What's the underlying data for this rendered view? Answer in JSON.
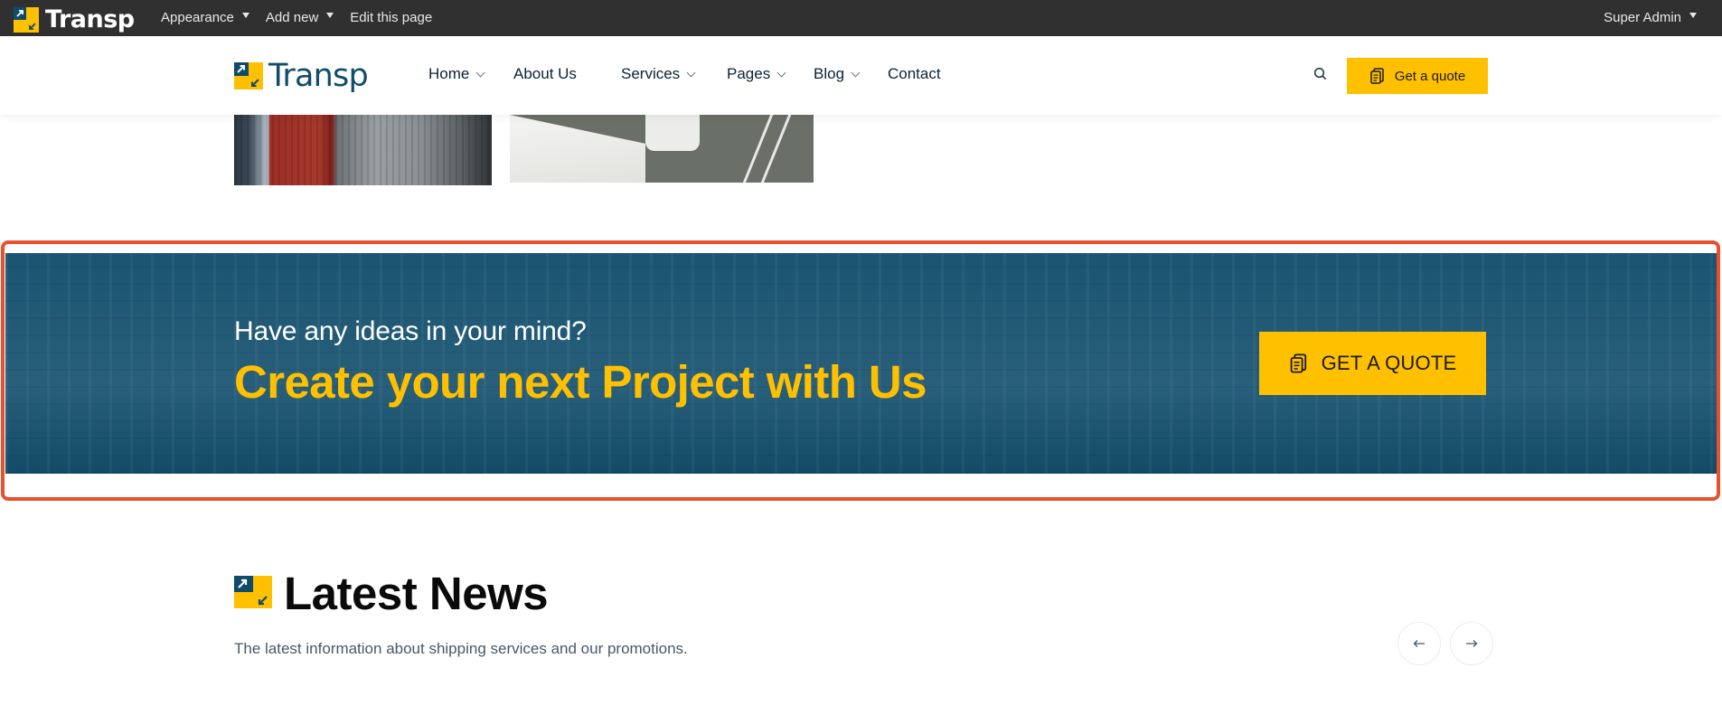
{
  "admin_bar": {
    "logo_text": "Transp",
    "menu": [
      {
        "label": "Appearance",
        "has_dropdown": true
      },
      {
        "label": "Add new",
        "has_dropdown": true
      },
      {
        "label": "Edit this page",
        "has_dropdown": false
      }
    ],
    "user": "Super Admin"
  },
  "header": {
    "brand": "Transp",
    "nav": [
      {
        "label": "Home",
        "has_dropdown": true
      },
      {
        "label": "About Us",
        "has_dropdown": false
      },
      {
        "label": "Services",
        "has_dropdown": true
      },
      {
        "label": "Pages",
        "has_dropdown": true
      },
      {
        "label": "Blog",
        "has_dropdown": true
      },
      {
        "label": "Contact",
        "has_dropdown": false
      }
    ],
    "search_icon": "search-icon",
    "quote_button": "Get a quote"
  },
  "cta": {
    "subtitle": "Have any ideas in your mind?",
    "title": "Create your next Project with Us",
    "button": "GET A QUOTE",
    "background_color": "#134f6d",
    "accent_color": "#ffc000"
  },
  "latest_news": {
    "title": "Latest News",
    "description": "The latest information about shipping services and our promotions.",
    "prev_icon": "arrow-left-icon",
    "next_icon": "arrow-right-icon"
  },
  "colors": {
    "brand_blue": "#0f4c6b",
    "brand_yellow": "#ffc000",
    "admin_bar": "#303030",
    "highlight_border": "#e8502e"
  }
}
